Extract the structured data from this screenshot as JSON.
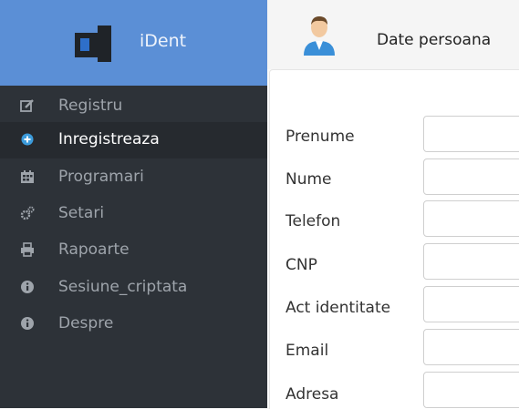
{
  "brand": {
    "name": "iDent",
    "logo_icon": "ident-logo-icon"
  },
  "colors": {
    "brand_bg": "#5b8fd6",
    "sidebar_bg": "#2d3238",
    "active_bg": "#262a2f",
    "active_dot": "#3b9bdb"
  },
  "sidebar": {
    "items": [
      {
        "label": "Registru",
        "icon": "edit-icon",
        "active": false
      },
      {
        "label": "Inregistreaza",
        "icon": "plus-circle-icon",
        "active": true
      },
      {
        "label": "Programari",
        "icon": "calendar-icon",
        "active": false
      },
      {
        "label": "Setari",
        "icon": "gears-icon",
        "active": false
      },
      {
        "label": "Rapoarte",
        "icon": "print-icon",
        "active": false
      },
      {
        "label": "Sesiune_criptata",
        "icon": "info-icon",
        "active": false
      },
      {
        "label": "Despre",
        "icon": "info-icon",
        "active": false
      }
    ]
  },
  "header": {
    "title": "Date persoana",
    "icon": "user-avatar-icon"
  },
  "form": {
    "fields": [
      {
        "label": "Prenume",
        "value": ""
      },
      {
        "label": "Nume",
        "value": ""
      },
      {
        "label": "Telefon",
        "value": ""
      },
      {
        "label": "CNP",
        "value": ""
      },
      {
        "label": "Act identitate",
        "value": ""
      },
      {
        "label": "Email",
        "value": ""
      },
      {
        "label": "Adresa",
        "value": ""
      }
    ]
  }
}
